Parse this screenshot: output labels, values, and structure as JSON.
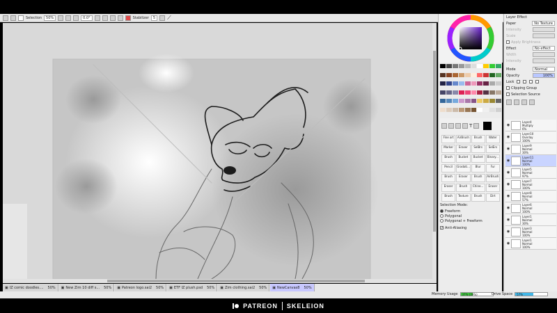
{
  "toolbar": {
    "selection_label": "Selection",
    "zoom_value": "50%",
    "rotation_value": "0.0°",
    "stabilizer_label": "Stabilizer",
    "stabilizer_value": "5"
  },
  "tabs": [
    {
      "name": "IZ comic doodles....",
      "pct": "50%"
    },
    {
      "name": "New Zim 10 diff s...",
      "pct": "50%"
    },
    {
      "name": "Patreon logo.sai2",
      "pct": "50%"
    },
    {
      "name": "ETF IZ plush.psd",
      "pct": "50%"
    },
    {
      "name": "Zim clothing.sai2",
      "pct": "50%"
    },
    {
      "name": "NewCanvas8",
      "pct": "50%"
    }
  ],
  "tools": [
    [
      "Fine art",
      "AirBrush",
      "Brush",
      "Water"
    ],
    [
      "Marker",
      "Eraser",
      "SelBrs",
      "SelErs"
    ],
    [
      "Brush",
      "Bucket",
      "Bucket",
      "Binary..."
    ],
    [
      "Pencil",
      "Gradati...",
      "Blur",
      "Fur"
    ],
    [
      "Brush",
      "Eraser",
      "Brush",
      "AirBrush"
    ],
    [
      "Eraser",
      "Brush",
      "Chine...",
      "Eraser"
    ],
    [
      "Brush",
      "Texture",
      "Brush",
      "Dirt"
    ]
  ],
  "selection_mode": {
    "label": "Selection Mode:",
    "options": [
      "Freeform",
      "Polygonal",
      "Polygonal + Freeform"
    ],
    "selected": 0,
    "anti_aliasing": "Anti-Aliasing"
  },
  "layer_effect": {
    "header": "Layer Effect",
    "paper_label": "Paper",
    "paper_value": "No Texture",
    "intensity": "Intensity",
    "scale": "Scale",
    "apply_brightness": "Apply Brightness",
    "effect_label": "Effect",
    "effect_value": "No effect",
    "width": "Width",
    "intensity2": "Intensity",
    "mode_label": "Mode",
    "mode_value": "Normal",
    "opacity_label": "Opacity",
    "opacity_value": "100%",
    "lock_label": "Lock",
    "clipping_group": "Clipping Group",
    "selection_source": "Selection Source"
  },
  "layers": [
    {
      "name": "Layer4",
      "mode": "Multiply",
      "opacity": "6%"
    },
    {
      "name": "Layer10",
      "mode": "Overlay",
      "opacity": "100%"
    },
    {
      "name": "Layer9",
      "mode": "Normal",
      "opacity": "30%"
    },
    {
      "name": "Layer11",
      "mode": "Normal",
      "opacity": "100%"
    },
    {
      "name": "Layer5",
      "mode": "Normal",
      "opacity": "97%"
    },
    {
      "name": "Layer7",
      "mode": "Normal",
      "opacity": "100%"
    },
    {
      "name": "Layer8",
      "mode": "Normal",
      "opacity": "57%"
    },
    {
      "name": "Layer6",
      "mode": "Normal",
      "opacity": "100%"
    },
    {
      "name": "Layer1",
      "mode": "Normal",
      "opacity": "30%"
    },
    {
      "name": "Layer3",
      "mode": "Normal",
      "opacity": "100%"
    },
    {
      "name": "Layer1",
      "mode": "Normal",
      "opacity": "100%"
    }
  ],
  "status": {
    "memory_label": "Memory Usage",
    "memory_value": "37% (39%)",
    "memory_fill": 0.37,
    "drive_label": "Drive Space",
    "drive_value": "57%",
    "drive_fill": 0.57
  },
  "watermark": {
    "patreon": "PATREON",
    "artist": "SKELEION"
  }
}
